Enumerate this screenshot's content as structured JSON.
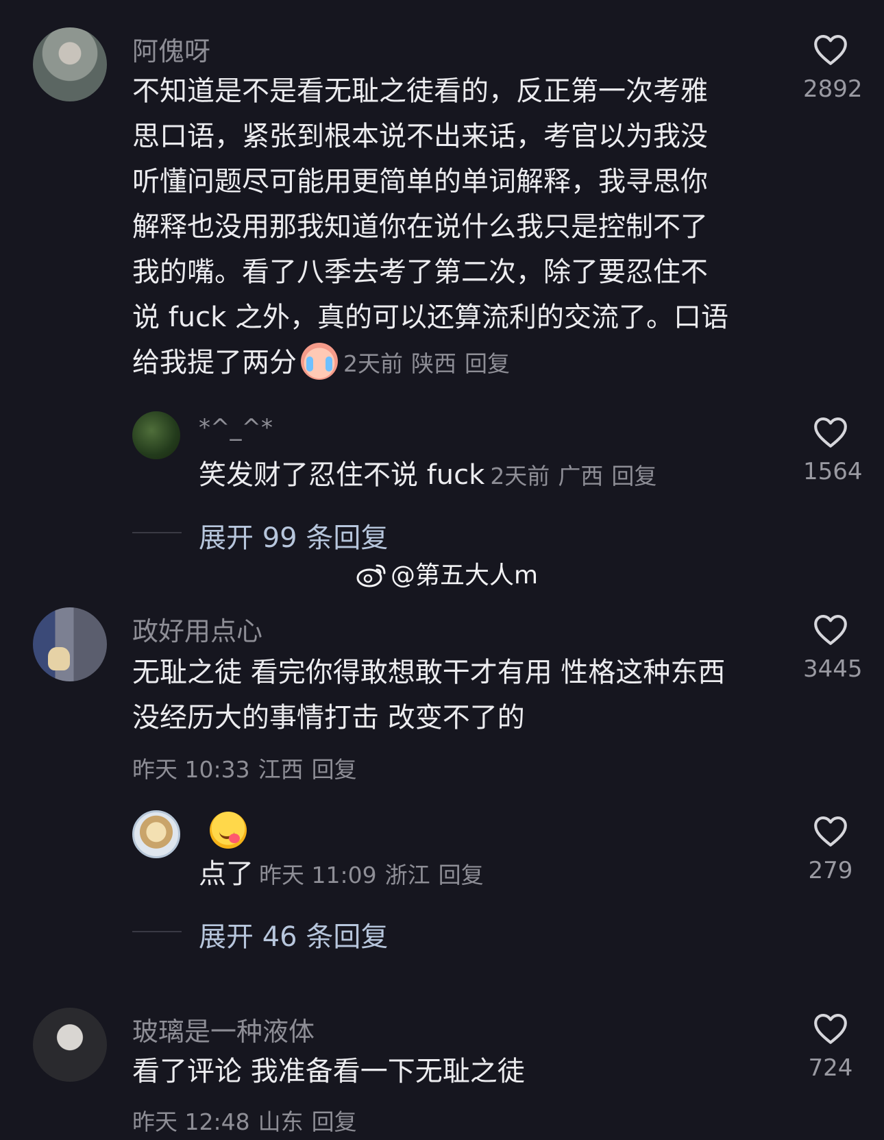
{
  "comments": [
    {
      "username": "阿傀呀",
      "lines": [
        "不知道是不是看无耻之徒看的，反正第一次考雅",
        "思口语，紧张到根本说不出来话，考官以为我没",
        "听懂问题尽可能用更简单的单词解释，我寻思你",
        "解释也没用那我知道你在说什么我只是控制不了",
        "我的嘴。看了八季去考了第二次，除了要忍住不",
        "说 fuck 之外，真的可以还算流利的交流了。口语",
        "给我提了两分"
      ],
      "time": "2天前",
      "location": "陕西",
      "reply_label": "回复",
      "likes": "2892",
      "reply": {
        "username": "*^_^*",
        "text": "笑发财了忍住不说 fuck",
        "time": "2天前",
        "location": "广西",
        "reply_label": "回复",
        "likes": "1564"
      },
      "expand": "展开 99 条回复"
    },
    {
      "username": "政好用点心",
      "lines": [
        "无耻之徒 看完你得敢想敢干才有用  性格这种东西",
        "没经历大的事情打击 改变不了的"
      ],
      "time": "昨天 10:33",
      "location": "江西",
      "reply_label": "回复",
      "likes": "3445",
      "reply": {
        "text": "点了",
        "time": "昨天 11:09",
        "location": "浙江",
        "reply_label": "回复",
        "likes": "279"
      },
      "expand": "展开 46 条回复"
    },
    {
      "username": "玻璃是一种液体",
      "lines": [
        "看了评论 我准备看一下无耻之徒"
      ],
      "time": "昨天 12:48",
      "location": "山东",
      "reply_label": "回复",
      "likes": "724"
    }
  ],
  "watermark": "@第五大人m",
  "icons": {
    "like": "heart-outline-icon",
    "emoji_cry": "crying-face-emoji",
    "emoji_yum": "yum-face-emoji",
    "weibo": "weibo-logo-icon"
  },
  "colors": {
    "background": "#16161f",
    "text": "#ececef",
    "muted": "#8e8e96",
    "expand": "#b7c6dc"
  }
}
